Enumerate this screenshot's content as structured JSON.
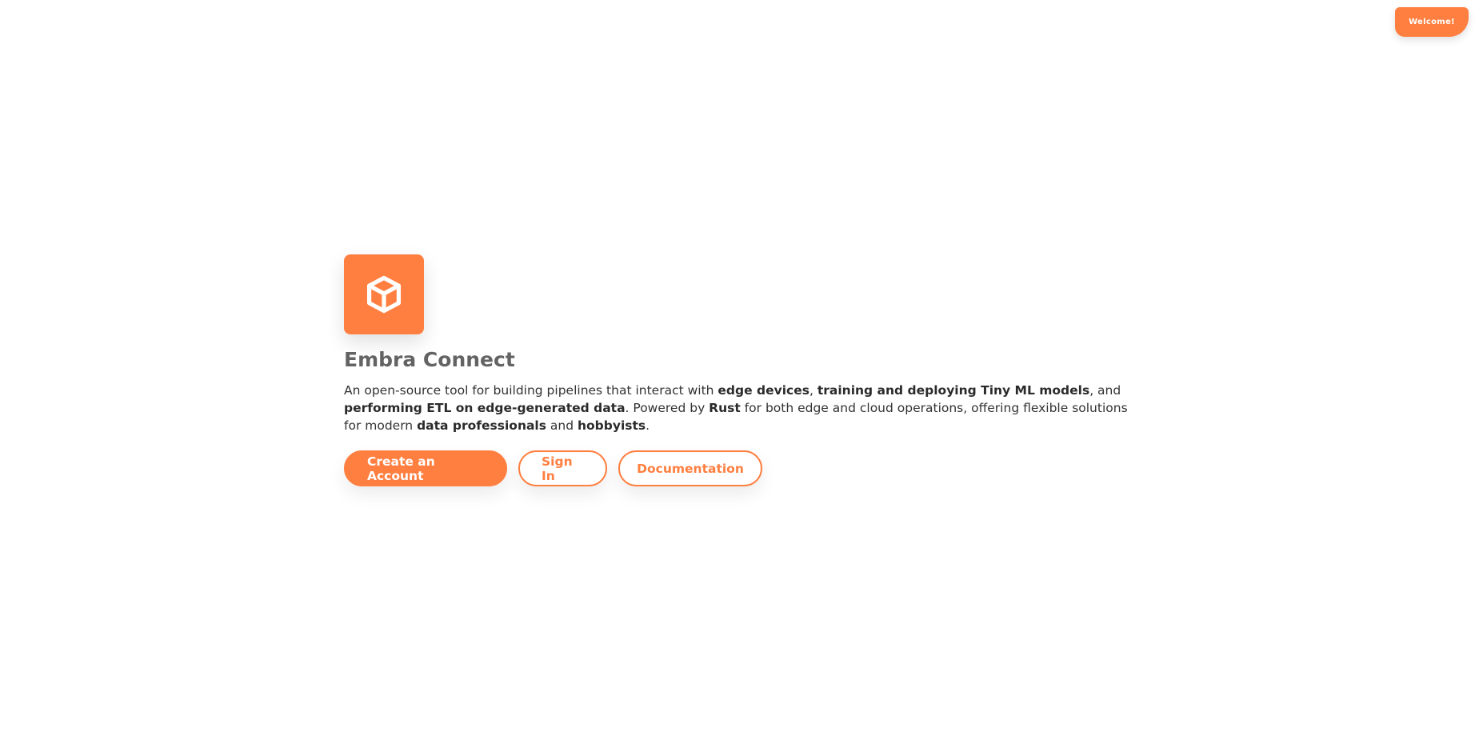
{
  "header": {
    "welcome_badge": "Welcome!"
  },
  "hero": {
    "logo_icon": "cube-icon",
    "title": "Embra Connect",
    "description": {
      "p1": "An open-source tool for building pipelines that interact with ",
      "b1": "edge devices",
      "p2": ", ",
      "b2": "training and deploying Tiny ML models",
      "p3": ", and ",
      "b3": "performing ETL on edge-generated data",
      "p4": ". Powered by ",
      "b4": "Rust",
      "p5": " for both edge and cloud operations, offering flexible solutions for modern ",
      "b5": "data professionals",
      "p6": " and ",
      "b6": "hobbyists",
      "p7": "."
    },
    "buttons": {
      "create_account": "Create an Account",
      "sign_in": "Sign In",
      "documentation": "Documentation"
    }
  },
  "colors": {
    "accent": "#ff7f40",
    "title": "#636363",
    "text": "#333333",
    "background": "#ffffff"
  }
}
